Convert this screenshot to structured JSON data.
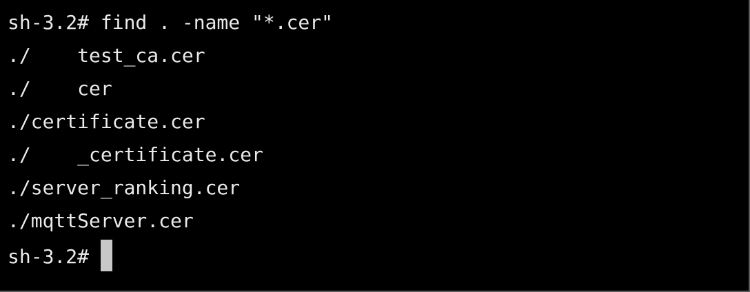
{
  "terminal": {
    "colors": {
      "background": "#000000",
      "foreground": "#eaeaea",
      "cursor": "#c8c8c8"
    },
    "lines": [
      "sh-3.2# find . -name \"*.cer\"",
      "./    test_ca.cer",
      "./    cer",
      "./certificate.cer",
      "./    _certificate.cer",
      "./server_ranking.cer",
      "./mqttServer.cer"
    ],
    "prompt": "sh-3.2# "
  }
}
